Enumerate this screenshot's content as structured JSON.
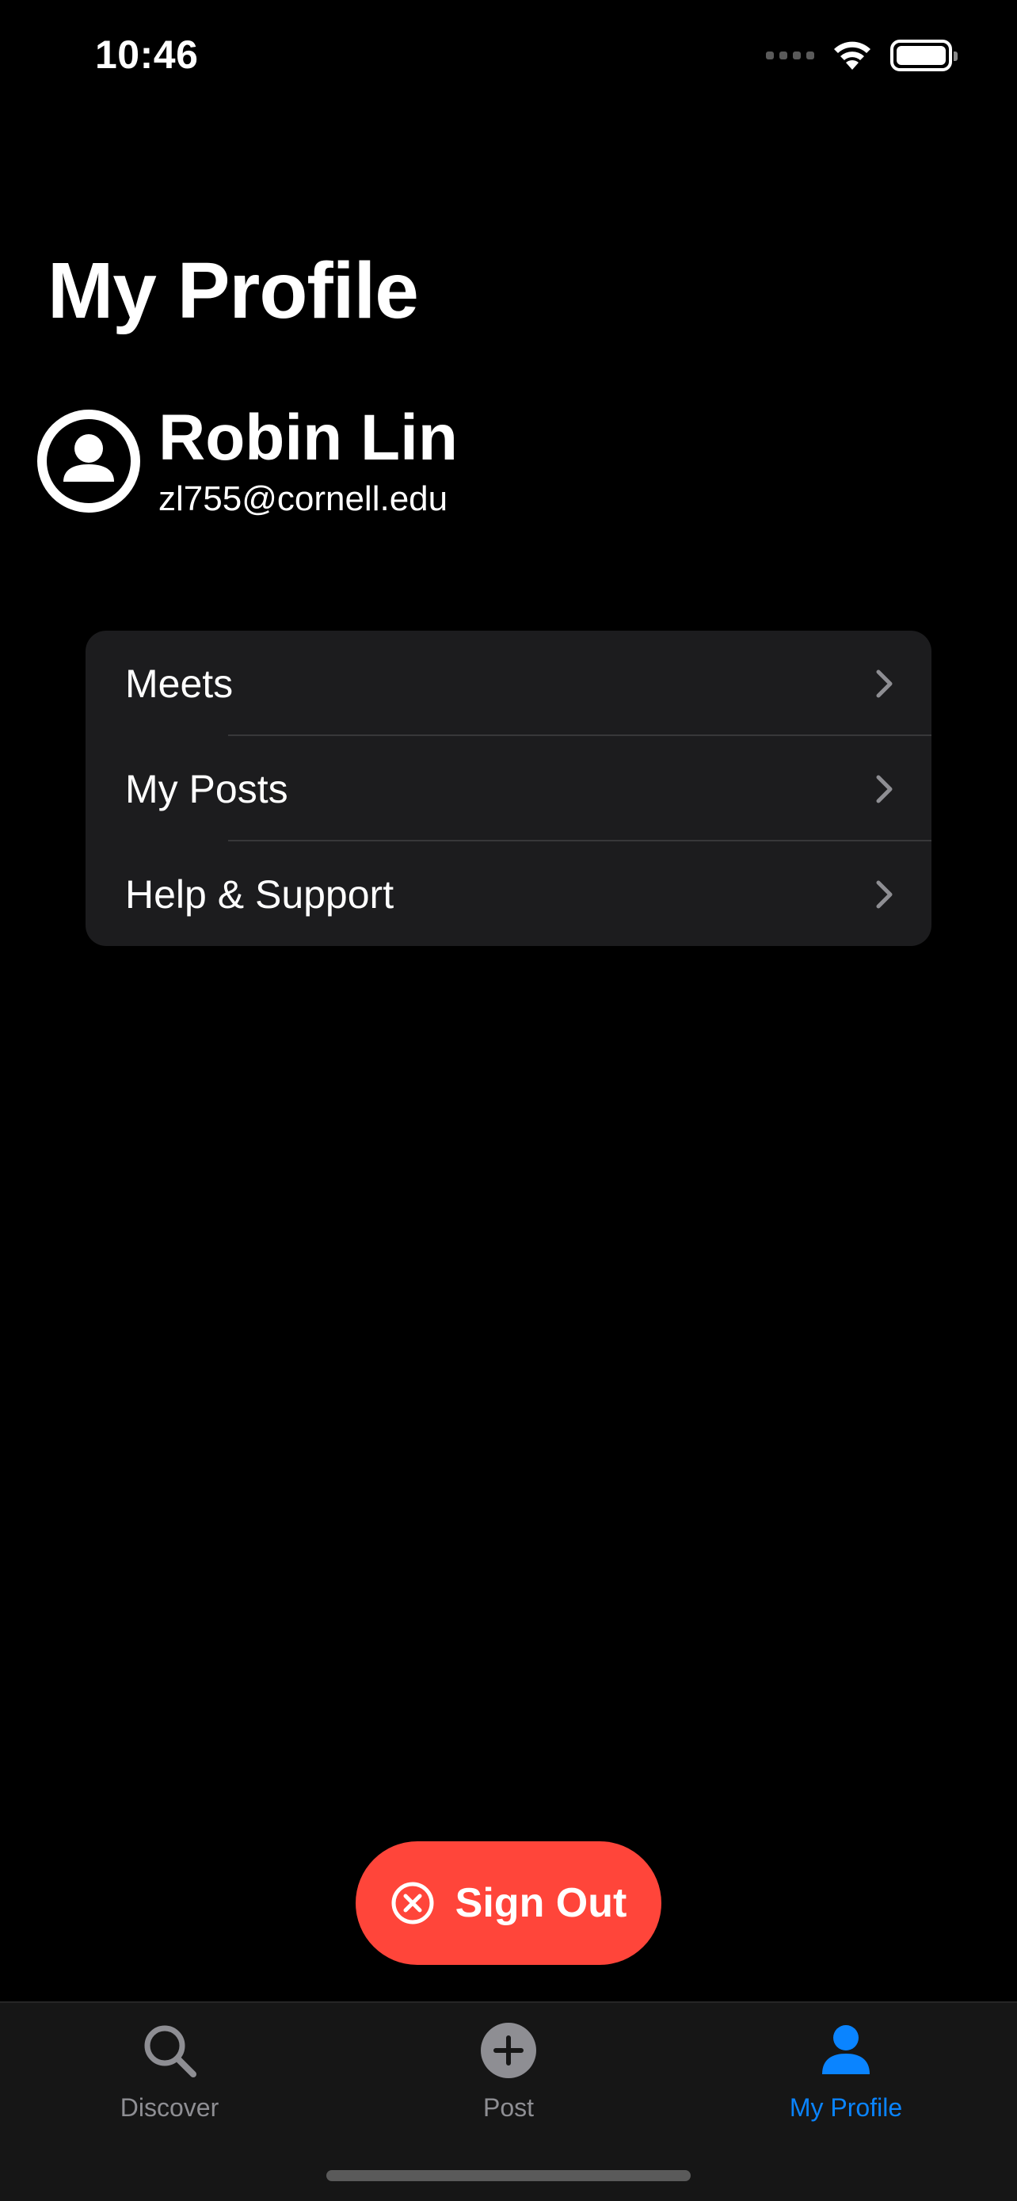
{
  "status_bar": {
    "time": "10:46",
    "signal_icon": "cellular-signal-icon",
    "wifi_icon": "wifi-icon",
    "battery_icon": "battery-icon"
  },
  "page": {
    "title": "My Profile"
  },
  "profile": {
    "avatar_icon": "person-circle-icon",
    "name": "Robin Lin",
    "email": "zl755@cornell.edu"
  },
  "menu": {
    "items": [
      {
        "label": "Meets",
        "icon": "chevron-right-icon"
      },
      {
        "label": "My Posts",
        "icon": "chevron-right-icon"
      },
      {
        "label": "Help & Support",
        "icon": "chevron-right-icon"
      }
    ]
  },
  "sign_out": {
    "label": "Sign Out",
    "icon": "x-circle-icon",
    "color": "#ff453a"
  },
  "tab_bar": {
    "tabs": [
      {
        "label": "Discover",
        "icon": "search-icon",
        "selected": false
      },
      {
        "label": "Post",
        "icon": "plus-circle-icon",
        "selected": false
      },
      {
        "label": "My Profile",
        "icon": "person-icon",
        "selected": true
      }
    ],
    "active_color": "#0a84ff",
    "inactive_color": "#8e8e93"
  }
}
